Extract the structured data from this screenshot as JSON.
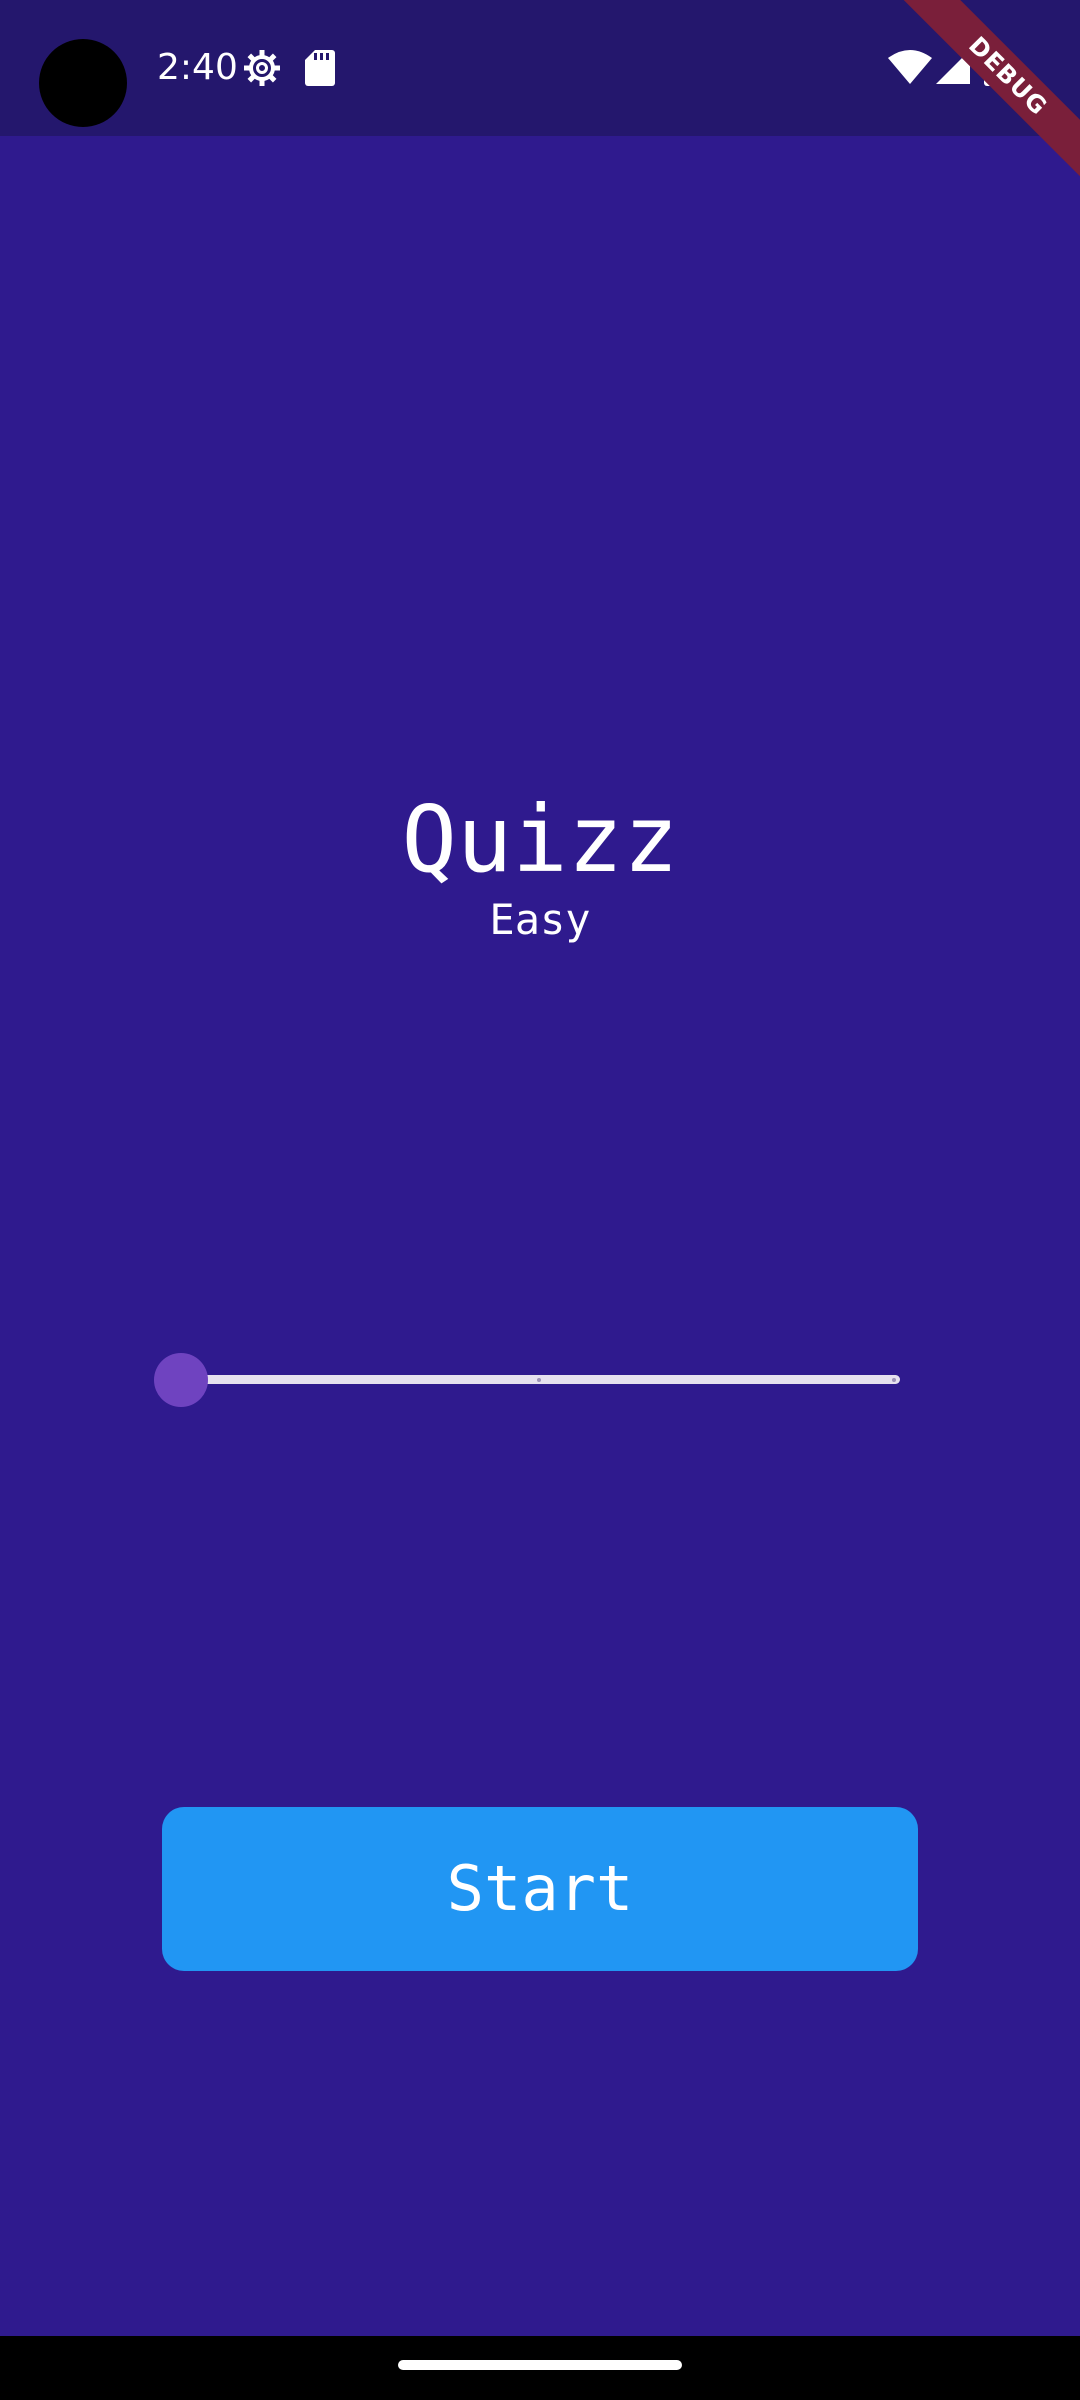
{
  "status_bar": {
    "time": "2:40",
    "icons": [
      "gear-icon",
      "sd-card-icon",
      "wifi-icon",
      "signal-icon",
      "battery-icon"
    ]
  },
  "debug_banner": {
    "label": "DEBUG",
    "color": "#7a1f3a"
  },
  "quiz": {
    "title": "Quizz",
    "difficulty": "Easy"
  },
  "slider": {
    "value": 0,
    "min": 0,
    "max": 2,
    "divisions": 2
  },
  "start_button": {
    "label": "Start",
    "color": "#2196f3"
  },
  "colors": {
    "background": "#2f1a8e",
    "status_bar": "#24176d",
    "slider_thumb": "#6f43c0",
    "slider_track": "#e6e1ef"
  }
}
